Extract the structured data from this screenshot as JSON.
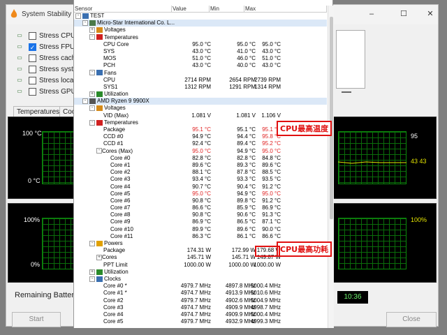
{
  "bg_window": {
    "title": "System Stability T",
    "checks": [
      {
        "label": "Stress CPU",
        "checked": false,
        "icon": "cpu-icon"
      },
      {
        "label": "Stress FPU",
        "checked": true,
        "icon": "fpu-icon"
      },
      {
        "label": "Stress cache",
        "checked": false,
        "icon": "cache-icon"
      },
      {
        "label": "Stress syster",
        "checked": false,
        "icon": "memory-icon"
      },
      {
        "label": "Stress local c",
        "checked": false,
        "icon": "disk-icon"
      },
      {
        "label": "Stress GPU(s",
        "checked": false,
        "icon": "gpu-icon"
      }
    ],
    "tabs": [
      "Temperatures",
      "Cool"
    ],
    "graph1": {
      "top": "100 °C",
      "bottom": "0 °C",
      "right_top": "95",
      "right_mid": "43 43"
    },
    "graph2": {
      "top": "100%",
      "bottom": "0%",
      "right_top": "100%"
    },
    "remaining_battery_label": "Remaining Battery:",
    "clock": "10:36",
    "start_label": "Start",
    "close_label": "Close"
  },
  "hw": {
    "columns": {
      "sensor": "Sensor",
      "value": "Value",
      "min": "Min",
      "max": "Max"
    },
    "rows": [
      {
        "indent": 0,
        "tw": "-",
        "icon": "computer-icon",
        "name": "TEST",
        "v": "",
        "mn": "",
        "mx": ""
      },
      {
        "indent": 1,
        "tw": "-",
        "icon": "board-icon",
        "name": "Micro-Star International Co. L...",
        "v": "",
        "mn": "",
        "mx": "",
        "sel": true
      },
      {
        "indent": 2,
        "tw": "+",
        "icon": "voltage-icon",
        "name": "Voltages",
        "v": "",
        "mn": "",
        "mx": ""
      },
      {
        "indent": 2,
        "tw": "-",
        "icon": "thermometer-icon",
        "name": "Temperatures",
        "v": "",
        "mn": "",
        "mx": ""
      },
      {
        "indent": 4,
        "name": "CPU Core",
        "v": "95.0 °C",
        "mn": "95.0 °C",
        "mx": "95.0 °C"
      },
      {
        "indent": 4,
        "name": "SYS",
        "v": "43.0 °C",
        "mn": "41.0 °C",
        "mx": "43.0 °C"
      },
      {
        "indent": 4,
        "name": "MOS",
        "v": "51.0 °C",
        "mn": "46.0 °C",
        "mx": "51.0 °C"
      },
      {
        "indent": 4,
        "name": "PCH",
        "v": "43.0 °C",
        "mn": "40.0 °C",
        "mx": "43.0 °C"
      },
      {
        "indent": 2,
        "tw": "-",
        "icon": "fan-icon",
        "name": "Fans",
        "v": "",
        "mn": "",
        "mx": ""
      },
      {
        "indent": 4,
        "name": "CPU",
        "v": "2714 RPM",
        "mn": "2654 RPM",
        "mx": "2739 RPM"
      },
      {
        "indent": 4,
        "name": "SYS1",
        "v": "1312 RPM",
        "mn": "1291 RPM",
        "mx": "1314 RPM"
      },
      {
        "indent": 2,
        "tw": "+",
        "icon": "utilization-icon",
        "name": "Utilization",
        "v": "",
        "mn": "",
        "mx": ""
      },
      {
        "indent": 1,
        "tw": "-",
        "icon": "chip-icon",
        "name": "AMD Ryzen 9 9900X",
        "v": "",
        "mn": "",
        "mx": "",
        "sel": true
      },
      {
        "indent": 2,
        "tw": "-",
        "icon": "voltage-icon",
        "name": "Voltages",
        "v": "",
        "mn": "",
        "mx": ""
      },
      {
        "indent": 4,
        "name": "VID (Max)",
        "v": "1.081 V",
        "mn": "1.081 V",
        "mx": "1.106 V"
      },
      {
        "indent": 2,
        "tw": "-",
        "icon": "thermometer-icon",
        "name": "Temperatures",
        "v": "",
        "mn": "",
        "mx": ""
      },
      {
        "indent": 4,
        "name": "Package",
        "v": "95.1 °C",
        "mn": "95.1 °C",
        "mx": "95.1 °C",
        "red_v": true,
        "red_mx": true
      },
      {
        "indent": 4,
        "name": "CCD #0",
        "v": "94.9 °C",
        "mn": "94.4 °C",
        "mx": "95.8 °C",
        "red_mx": true
      },
      {
        "indent": 4,
        "name": "CCD #1",
        "v": "92.4 °C",
        "mn": "89.4 °C",
        "mx": "95.2 °C",
        "red_mx": true
      },
      {
        "indent": 3,
        "tw": "-",
        "name": "Cores (Max)",
        "v": "95.0 °C",
        "mn": "94.9 °C",
        "mx": "95.0 °C",
        "red_v": true,
        "red_mx": true
      },
      {
        "indent": 5,
        "name": "Core #0",
        "v": "82.8 °C",
        "mn": "82.8 °C",
        "mx": "84.8 °C"
      },
      {
        "indent": 5,
        "name": "Core #1",
        "v": "89.6 °C",
        "mn": "89.3 °C",
        "mx": "89.6 °C"
      },
      {
        "indent": 5,
        "name": "Core #2",
        "v": "88.1 °C",
        "mn": "87.8 °C",
        "mx": "88.5 °C"
      },
      {
        "indent": 5,
        "name": "Core #3",
        "v": "93.4 °C",
        "mn": "93.3 °C",
        "mx": "93.5 °C"
      },
      {
        "indent": 5,
        "name": "Core #4",
        "v": "90.7 °C",
        "mn": "90.4 °C",
        "mx": "91.2 °C"
      },
      {
        "indent": 5,
        "name": "Core #5",
        "v": "95.0 °C",
        "mn": "94.9 °C",
        "mx": "95.0 °C",
        "red_v": true,
        "red_mx": true
      },
      {
        "indent": 5,
        "name": "Core #6",
        "v": "90.8 °C",
        "mn": "89.8 °C",
        "mx": "91.2 °C"
      },
      {
        "indent": 5,
        "name": "Core #7",
        "v": "86.6 °C",
        "mn": "85.9 °C",
        "mx": "86.9 °C"
      },
      {
        "indent": 5,
        "name": "Core #8",
        "v": "90.8 °C",
        "mn": "90.6 °C",
        "mx": "91.3 °C"
      },
      {
        "indent": 5,
        "name": "Core #9",
        "v": "86.9 °C",
        "mn": "86.5 °C",
        "mx": "87.1 °C"
      },
      {
        "indent": 5,
        "name": "Core #10",
        "v": "89.9 °C",
        "mn": "89.6 °C",
        "mx": "90.0 °C"
      },
      {
        "indent": 5,
        "name": "Core #11",
        "v": "86.3 °C",
        "mn": "86.1 °C",
        "mx": "86.6 °C"
      },
      {
        "indent": 2,
        "tw": "-",
        "icon": "power-icon",
        "name": "Powers",
        "v": "",
        "mn": "",
        "mx": ""
      },
      {
        "indent": 4,
        "name": "Package",
        "v": "174.31 W",
        "mn": "172.99 W",
        "mx": "179.68 W"
      },
      {
        "indent": 3,
        "tw": "+",
        "name": "Cores",
        "v": "145.71 W",
        "mn": "145.71 W",
        "mx": "149.87 W"
      },
      {
        "indent": 4,
        "name": "PPT Limit",
        "v": "1000.00 W",
        "mn": "1000.00 W",
        "mx": "1000.00 W"
      },
      {
        "indent": 2,
        "tw": "+",
        "icon": "utilization-icon",
        "name": "Utilization",
        "v": "",
        "mn": "",
        "mx": ""
      },
      {
        "indent": 2,
        "tw": "-",
        "icon": "clock-icon",
        "name": "Clocks",
        "v": "",
        "mn": "",
        "mx": ""
      },
      {
        "indent": 4,
        "name": "Core #0 *",
        "v": "4979.7 MHz",
        "mn": "4897.8 MHz",
        "mx": "5000.4 MHz"
      },
      {
        "indent": 4,
        "name": "Core #1 *",
        "v": "4974.7 MHz",
        "mn": "4913.9 MHz",
        "mx": "5010.6 MHz"
      },
      {
        "indent": 4,
        "name": "Core #2",
        "v": "4979.7 MHz",
        "mn": "4902.6 MHz",
        "mx": "5004.9 MHz"
      },
      {
        "indent": 4,
        "name": "Core #3",
        "v": "4974.7 MHz",
        "mn": "4909.9 MHz",
        "mx": "4998.7 MHz"
      },
      {
        "indent": 4,
        "name": "Core #4",
        "v": "4974.7 MHz",
        "mn": "4909.9 MHz",
        "mx": "5000.4 MHz"
      },
      {
        "indent": 4,
        "name": "Core #5",
        "v": "4979.7 MHz",
        "mn": "4932.9 MHz",
        "mx": "4999.3 MHz"
      }
    ]
  },
  "annotations": {
    "cpu_max_temp": "CPU最高温度",
    "cpu_max_power": "CPU最高功耗"
  },
  "colors": {
    "accent_red": "#e01010",
    "graph_green": "#0c8a0c",
    "selection": "#dbe8f7"
  }
}
